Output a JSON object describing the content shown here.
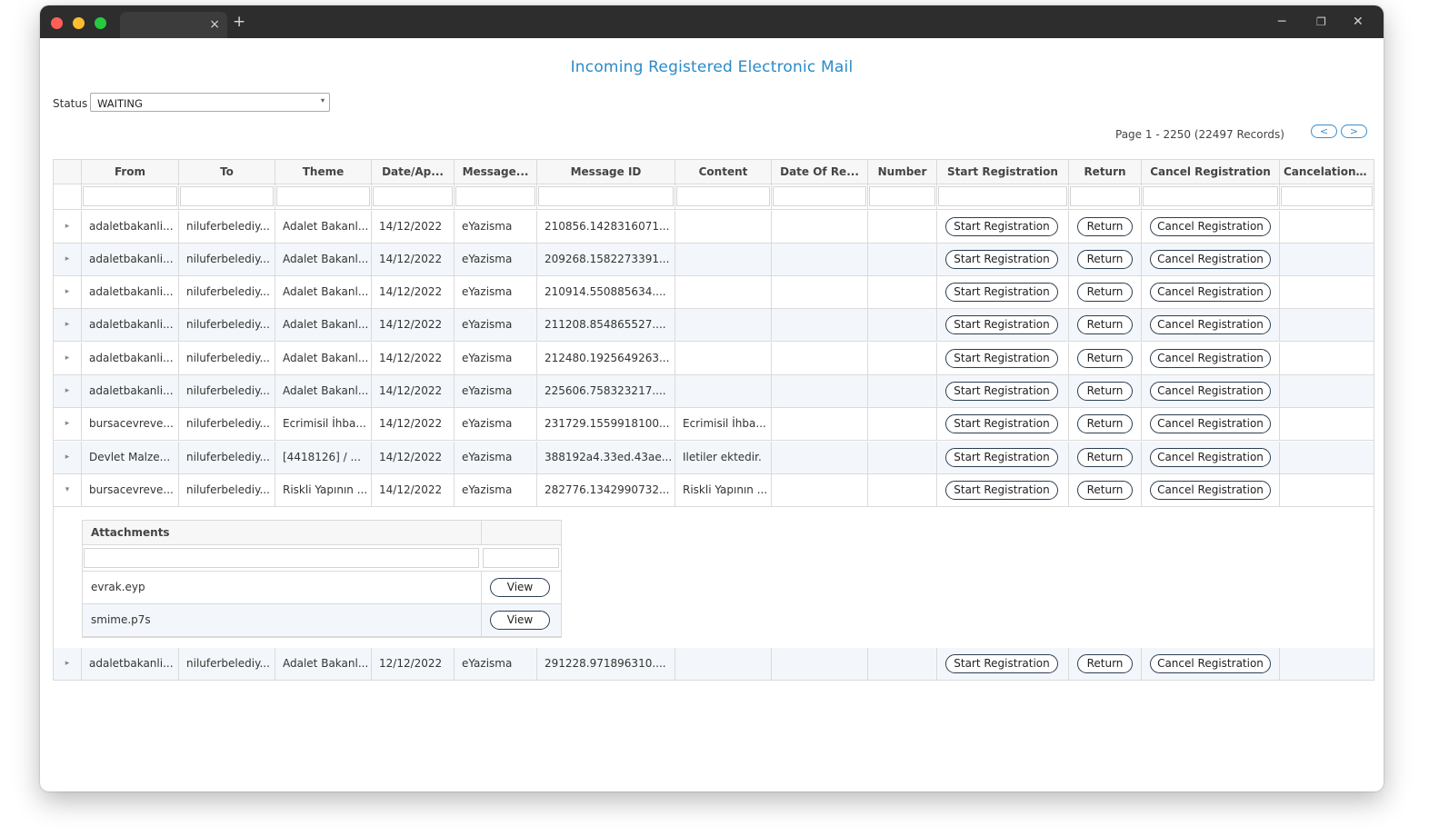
{
  "window": {
    "tab_close": "×",
    "new_tab": "+",
    "minimize": "─",
    "maximize": "❐",
    "close": "✕"
  },
  "page": {
    "title": "Incoming Registered Electronic Mail"
  },
  "status_filter": {
    "label": "Status",
    "value": "WAITING",
    "arrow": "▾"
  },
  "pager": {
    "text": "Page 1 - 2250 (22497 Records)",
    "prev": "<",
    "next": ">"
  },
  "table": {
    "columns": [
      "From",
      "To",
      "Theme",
      "Date/Ap...",
      "Message...",
      "Message ID",
      "Content",
      "Date Of Re...",
      "Number",
      "Start Registration",
      "Return",
      "Cancel Registration",
      "Cancelation ..."
    ],
    "action_labels": {
      "start": "Start Registration",
      "return": "Return",
      "cancel": "Cancel Registration"
    },
    "expand_icon": "▸",
    "collapse_icon": "▾",
    "rows": [
      {
        "from": "adaletbakanli...",
        "to": "niluferbelediy...",
        "theme": "Adalet Bakanl...",
        "date": "14/12/2022",
        "message": "eYazisma",
        "message_id": "210856.1428316071...",
        "content": "",
        "date_of_reg": "",
        "number": "",
        "cancelation": ""
      },
      {
        "from": "adaletbakanli...",
        "to": "niluferbelediy...",
        "theme": "Adalet Bakanl...",
        "date": "14/12/2022",
        "message": "eYazisma",
        "message_id": "209268.1582273391...",
        "content": "",
        "date_of_reg": "",
        "number": "",
        "cancelation": ""
      },
      {
        "from": "adaletbakanli...",
        "to": "niluferbelediy...",
        "theme": "Adalet Bakanl...",
        "date": "14/12/2022",
        "message": "eYazisma",
        "message_id": "210914.550885634....",
        "content": "",
        "date_of_reg": "",
        "number": "",
        "cancelation": ""
      },
      {
        "from": "adaletbakanli...",
        "to": "niluferbelediy...",
        "theme": "Adalet Bakanl...",
        "date": "14/12/2022",
        "message": "eYazisma",
        "message_id": "211208.854865527....",
        "content": "",
        "date_of_reg": "",
        "number": "",
        "cancelation": ""
      },
      {
        "from": "adaletbakanli...",
        "to": "niluferbelediy...",
        "theme": "Adalet Bakanl...",
        "date": "14/12/2022",
        "message": "eYazisma",
        "message_id": "212480.1925649263...",
        "content": "",
        "date_of_reg": "",
        "number": "",
        "cancelation": ""
      },
      {
        "from": "adaletbakanli...",
        "to": "niluferbelediy...",
        "theme": "Adalet Bakanl...",
        "date": "14/12/2022",
        "message": "eYazisma",
        "message_id": "225606.758323217....",
        "content": "",
        "date_of_reg": "",
        "number": "",
        "cancelation": ""
      },
      {
        "from": "bursacevreve...",
        "to": "niluferbelediy...",
        "theme": "Ecrimisil İhba...",
        "date": "14/12/2022",
        "message": "eYazisma",
        "message_id": "231729.1559918100...",
        "content": "Ecrimisil İhba...",
        "date_of_reg": "",
        "number": "",
        "cancelation": ""
      },
      {
        "from": "Devlet Malze...",
        "to": "niluferbelediy...",
        "theme": "[4418126] / ...",
        "date": "14/12/2022",
        "message": "eYazisma",
        "message_id": "388192a4.33ed.43ae...",
        "content": "Iletiler ektedir.",
        "date_of_reg": "",
        "number": "",
        "cancelation": ""
      },
      {
        "from": "bursacevreve...",
        "to": "niluferbelediy...",
        "theme": "Riskli Yapının ...",
        "date": "14/12/2022",
        "message": "eYazisma",
        "message_id": "282776.1342990732...",
        "content": "Riskli Yapının ...",
        "date_of_reg": "",
        "number": "",
        "cancelation": ""
      }
    ],
    "last_row": {
      "from": "adaletbakanli...",
      "to": "niluferbelediy...",
      "theme": "Adalet Bakanl...",
      "date": "12/12/2022",
      "message": "eYazisma",
      "message_id": "291228.971896310....",
      "content": "",
      "date_of_reg": "",
      "number": "",
      "cancelation": ""
    }
  },
  "attachments": {
    "header": "Attachments",
    "view_label": "View",
    "items": [
      "evrak.eyp",
      "smime.p7s"
    ]
  },
  "colors": {
    "title": "#2c8ac8",
    "titlebar": "#2d2d2d",
    "row_alt": "#f3f7fb",
    "pill_border": "#2c3e50"
  }
}
